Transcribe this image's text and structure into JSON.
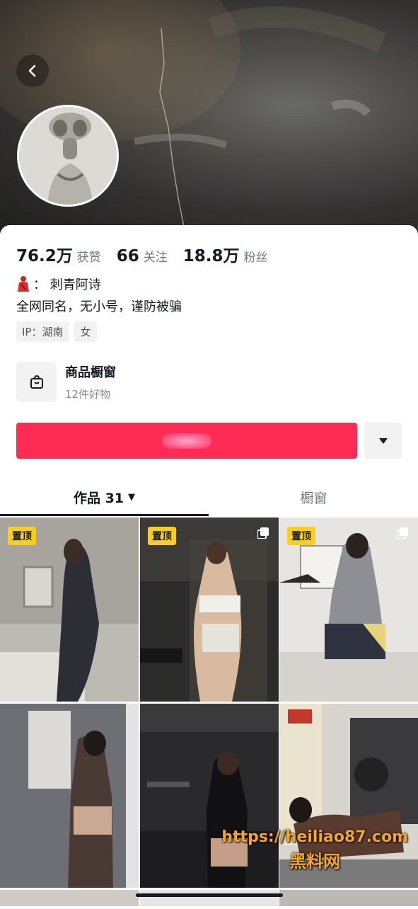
{
  "header": {
    "back_icon": "chevron-left-icon",
    "avatar_alt": "avatar"
  },
  "stats": [
    {
      "num": "76.2万",
      "label": "获赞"
    },
    {
      "num": "66",
      "label": "关注"
    },
    {
      "num": "18.8万",
      "label": "粉丝"
    }
  ],
  "bio": {
    "line1_icon": "red-figure-emoji",
    "line1": "： 刺青阿诗",
    "line2": "全网同名，无小号，谨防被骗"
  },
  "tags": [
    "IP：湖南",
    "女"
  ],
  "shop": {
    "icon": "shopping-bag-icon",
    "title": "商品橱窗",
    "subtitle": "12件好物"
  },
  "follow_button_color": "#fe2c55",
  "more_icon": "caret-down-icon",
  "tabs": {
    "works": "作品 31",
    "showcase": "橱窗"
  },
  "grid": {
    "pinned_label": "置顶",
    "tiles": [
      {
        "pinned": true,
        "multi": false
      },
      {
        "pinned": true,
        "multi": true
      },
      {
        "pinned": true,
        "multi": true
      },
      {
        "pinned": false,
        "multi": false
      },
      {
        "pinned": false,
        "multi": false
      },
      {
        "pinned": false,
        "multi": false
      }
    ]
  },
  "watermark": {
    "line1": "https://heiliao87.com",
    "line2": "黑料网"
  }
}
